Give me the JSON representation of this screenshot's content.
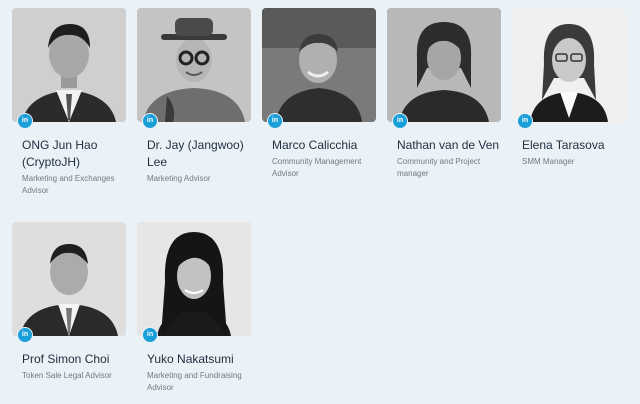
{
  "team": [
    {
      "name": "ONG Jun Hao (CryptoJH)",
      "role": "Marketing and Exchanges Advisor",
      "photo": "portrait-ong-jun-hao",
      "icon": "linkedin-icon",
      "icon_text": "in"
    },
    {
      "name": "Dr. Jay (Jangwoo) Lee",
      "role": "Marketing Advisor",
      "photo": "portrait-jay-lee",
      "icon": "linkedin-icon",
      "icon_text": "in"
    },
    {
      "name": "Marco Calicchia",
      "role": "Community Management Advisor",
      "photo": "portrait-marco-calicchia",
      "icon": "linkedin-icon",
      "icon_text": "in"
    },
    {
      "name": "Nathan van de Ven",
      "role": "Community and Project manager",
      "photo": "portrait-nathan-van-de-ven",
      "icon": "linkedin-icon",
      "icon_text": "in"
    },
    {
      "name": "Elena Tarasova",
      "role": "SMM Manager",
      "photo": "portrait-elena-tarasova",
      "icon": "linkedin-icon",
      "icon_text": "in"
    },
    {
      "name": "Prof Simon Choi",
      "role": "Token Sale Legal Advisor",
      "photo": "portrait-simon-choi",
      "icon": "linkedin-icon",
      "icon_text": "in"
    },
    {
      "name": "Yuko Nakatsumi",
      "role": "Marketing and Fundraising Advisor",
      "photo": "portrait-yuko-nakatsumi",
      "icon": "linkedin-icon",
      "icon_text": "in"
    }
  ],
  "colors": {
    "background": "#eaf2f8",
    "linkedin": "#1a9fd9",
    "name_text": "#1f2d3d",
    "role_text": "#6d7a86"
  }
}
